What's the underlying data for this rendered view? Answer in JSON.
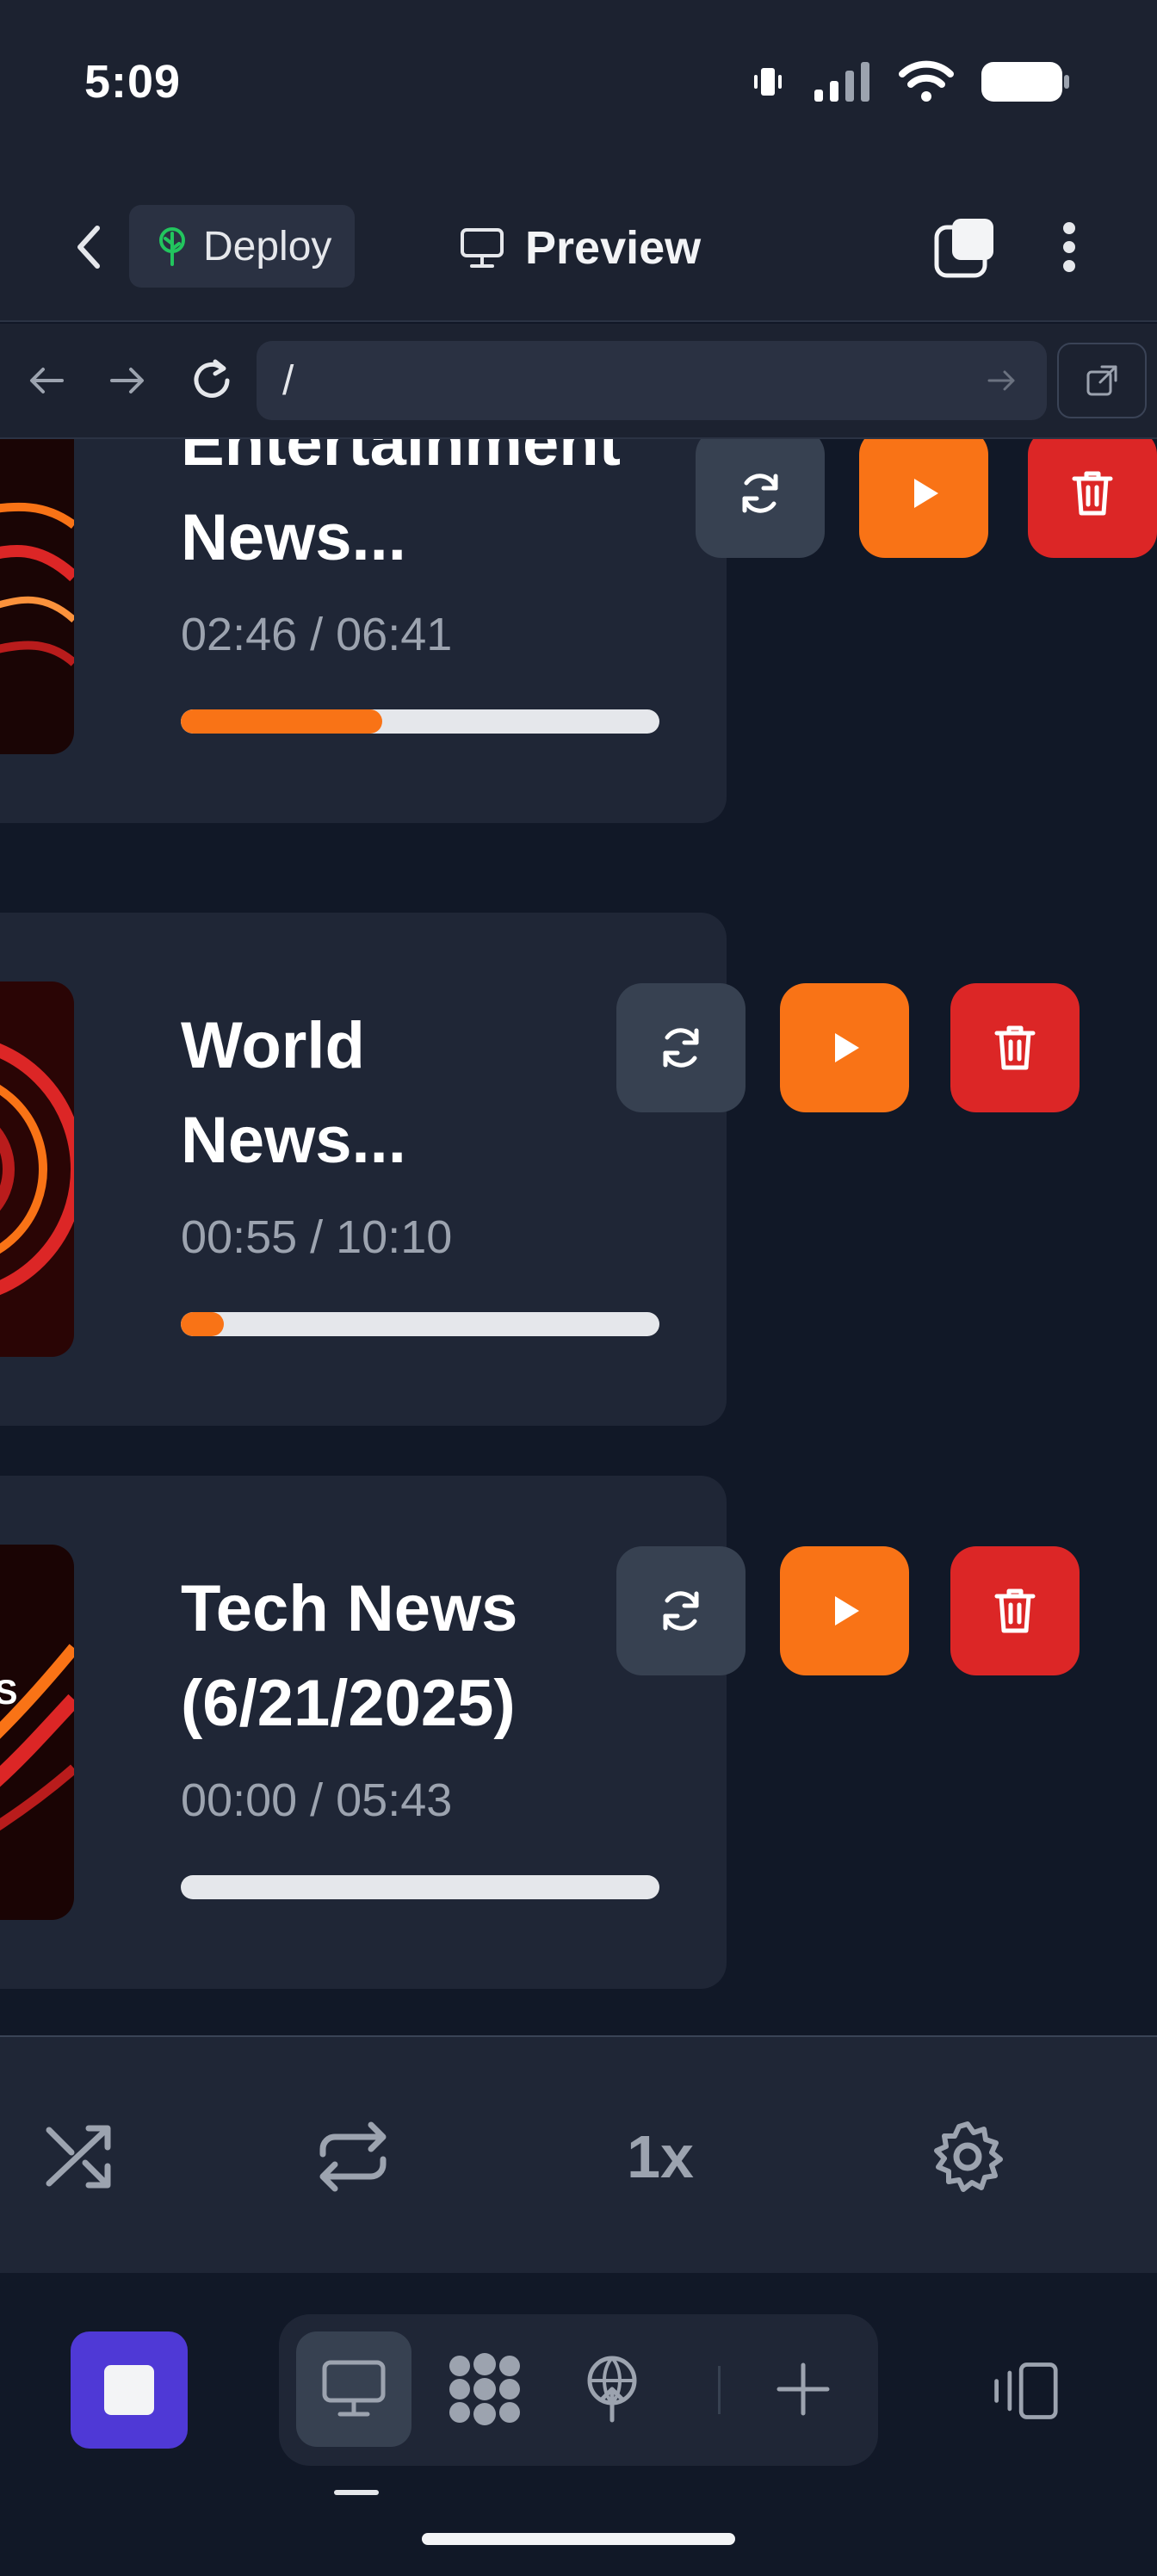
{
  "status_bar": {
    "time": "5:09"
  },
  "app_bar": {
    "deploy_label": "Deploy",
    "preview_label": "Preview"
  },
  "url_bar": {
    "url": "/"
  },
  "tracks": [
    {
      "title_line1": "Entertainment",
      "title_line2": "News...",
      "time": "02:46 / 06:41",
      "progress": 0.42
    },
    {
      "title_line1": "World",
      "title_line2": "News...",
      "time": "00:55 / 10:10",
      "progress": 0.09
    },
    {
      "title_line1": "Tech News",
      "title_line2": "(6/21/2025)",
      "time": "00:00 / 05:43",
      "progress": 0.0
    }
  ],
  "thumb_overlay_text": "WS",
  "player": {
    "speed_label": "1x"
  },
  "colors": {
    "accent_orange": "#f97316",
    "danger_red": "#dc2626",
    "stop_purple": "#4f39d6",
    "deploy_green": "#22c55e"
  },
  "icons": [
    "back-icon",
    "tree-icon",
    "monitor-icon",
    "tabs-icon",
    "more-icon",
    "arrow-left-icon",
    "arrow-right-icon",
    "reload-icon",
    "go-icon",
    "external-link-icon",
    "refresh-icon",
    "play-icon",
    "trash-icon",
    "shuffle-icon",
    "repeat-icon",
    "gear-icon",
    "stop-icon",
    "grid-dots-icon",
    "deploy-icon",
    "plus-icon",
    "device-icon"
  ]
}
